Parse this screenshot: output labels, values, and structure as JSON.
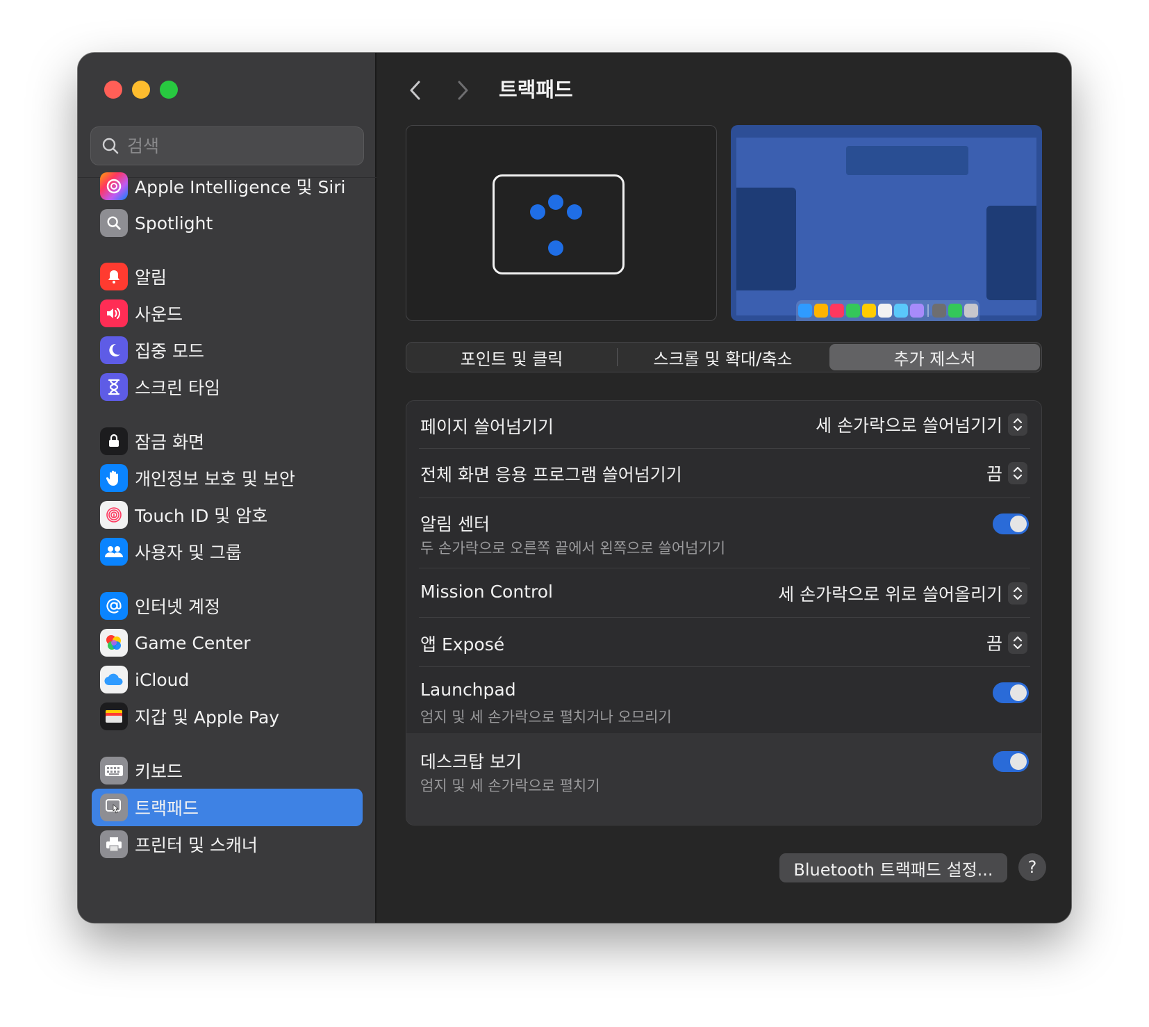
{
  "window": {
    "title": "트랙패드"
  },
  "search": {
    "placeholder": "검색"
  },
  "sidebar": {
    "items": [
      {
        "label": "Apple Intelligence 및 Siri",
        "icon": "apple-intelligence-siri-icon",
        "color": "#b36bff"
      },
      {
        "label": "Spotlight",
        "icon": "spotlight-icon",
        "color": "#8e8e93"
      },
      {
        "label": "알림",
        "icon": "notifications-icon",
        "color": "#ff3b30"
      },
      {
        "label": "사운드",
        "icon": "sound-icon",
        "color": "#ff2d55"
      },
      {
        "label": "집중 모드",
        "icon": "focus-icon",
        "color": "#5e5ce6"
      },
      {
        "label": "스크린 타임",
        "icon": "screen-time-icon",
        "color": "#5e5ce6"
      },
      {
        "label": "잠금 화면",
        "icon": "lock-screen-icon",
        "color": "#1c1c1e"
      },
      {
        "label": "개인정보 보호 및 보안",
        "icon": "privacy-hand-icon",
        "color": "#0a84ff"
      },
      {
        "label": "Touch ID 및 암호",
        "icon": "touch-id-icon",
        "color": "#f2f2f2"
      },
      {
        "label": "사용자 및 그룹",
        "icon": "users-groups-icon",
        "color": "#0a84ff"
      },
      {
        "label": "인터넷 계정",
        "icon": "internet-accounts-icon",
        "color": "#0a84ff"
      },
      {
        "label": "Game Center",
        "icon": "game-center-icon",
        "color": "#f2f2f2"
      },
      {
        "label": "iCloud",
        "icon": "icloud-icon",
        "color": "#f2f2f2"
      },
      {
        "label": "지갑 및 Apple Pay",
        "icon": "wallet-icon",
        "color": "#1c1c1e"
      },
      {
        "label": "키보드",
        "icon": "keyboard-icon",
        "color": "#8e8e93"
      },
      {
        "label": "트랙패드",
        "icon": "trackpad-icon",
        "color": "#8e8e93",
        "selected": true
      },
      {
        "label": "프린터 및 스캐너",
        "icon": "printer-icon",
        "color": "#8e8e93"
      }
    ]
  },
  "tabs": [
    {
      "label": "포인트 및 클릭"
    },
    {
      "label": "스크롤 및 확대/축소"
    },
    {
      "label": "추가 제스처",
      "selected": true
    }
  ],
  "settings": [
    {
      "title": "페이지 쓸어넘기기",
      "control": "popup",
      "value": "세 손가락으로 쓸어넘기기"
    },
    {
      "title": "전체 화면 응용 프로그램 쓸어넘기기",
      "control": "popup",
      "value": "끔"
    },
    {
      "title": "알림 센터",
      "subtitle": "두 손가락으로 오른쪽 끝에서 왼쪽으로 쓸어넘기기",
      "control": "toggle",
      "on": true
    },
    {
      "title": "Mission Control",
      "control": "popup",
      "value": "세 손가락으로 위로 쓸어올리기"
    },
    {
      "title": "앱 Exposé",
      "control": "popup",
      "value": "끔"
    },
    {
      "title": "Launchpad",
      "subtitle": "엄지 및 세 손가락으로 펼치거나 오므리기",
      "control": "toggle",
      "on": true
    },
    {
      "title": "데스크탑 보기",
      "subtitle": "엄지 및 세 손가락으로 펼치기",
      "control": "toggle",
      "on": true
    }
  ],
  "buttons": {
    "bluetooth": "Bluetooth 트랙패드 설정...",
    "help": "?"
  },
  "colors": {
    "accent": "#3e82e4",
    "toggle_on": "#2a6bd8",
    "sidebar_bg": "#3a3a3c",
    "main_bg": "#262626"
  }
}
